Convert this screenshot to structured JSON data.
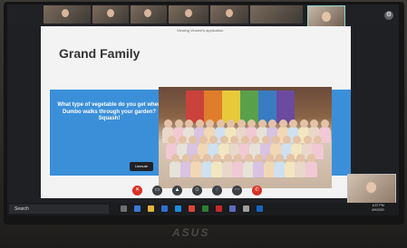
{
  "meeting": {
    "presenting_notice": "Viewing Vincent's application",
    "participants": [
      "",
      "",
      "",
      "",
      ""
    ]
  },
  "slide": {
    "title": "Grand Family",
    "riddle": "What type of vegetable do you get when Dumbo walks through your garden? Squash!"
  },
  "controls": {
    "unmute_label": "Unmute",
    "buttons": [
      "mic-off-icon",
      "camera-icon",
      "present-icon",
      "emoji-icon",
      "chat-icon",
      "more-icon",
      "end-call-icon"
    ]
  },
  "taskbar": {
    "search_label": "Search",
    "time": "4:37 PM",
    "date": "4/9/2020"
  },
  "laptop": {
    "brand": "ASUS"
  }
}
